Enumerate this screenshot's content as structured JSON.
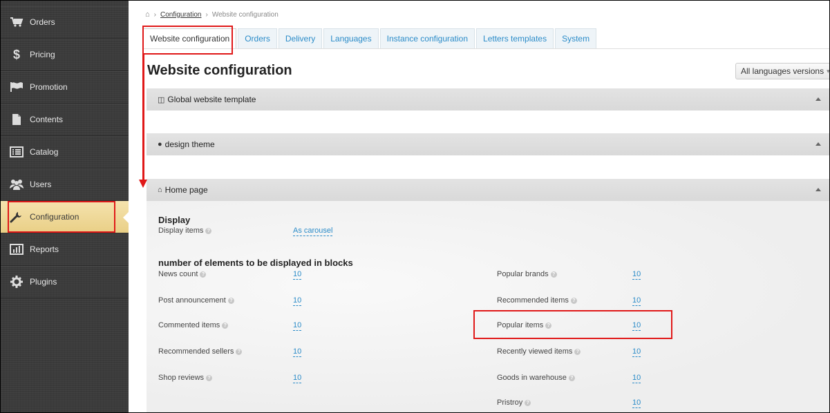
{
  "sidebar": {
    "items": [
      {
        "label": "Orders",
        "icon": "cart-icon"
      },
      {
        "label": "Pricing",
        "icon": "dollar-icon"
      },
      {
        "label": "Promotion",
        "icon": "flag-icon"
      },
      {
        "label": "Contents",
        "icon": "document-icon"
      },
      {
        "label": "Catalog",
        "icon": "list-icon"
      },
      {
        "label": "Users",
        "icon": "users-icon"
      },
      {
        "label": "Configuration",
        "icon": "wrench-icon"
      },
      {
        "label": "Reports",
        "icon": "bar-chart-icon"
      },
      {
        "label": "Plugins",
        "icon": "gear-icon"
      }
    ],
    "active": "Configuration"
  },
  "breadcrumb": {
    "home_icon": "home-icon",
    "link": "Configuration",
    "current": "Website configuration"
  },
  "tabs": [
    "Website configuration",
    "Orders",
    "Delivery",
    "Languages",
    "Instance configuration",
    "Letters templates",
    "System"
  ],
  "active_tab": "Website configuration",
  "page": {
    "title": "Website configuration",
    "lang_button": "All languages versions"
  },
  "panels": {
    "global": {
      "title": "Global website template"
    },
    "design": {
      "title": "design theme"
    },
    "home": {
      "title": "Home page"
    }
  },
  "display": {
    "title": "Display",
    "items_label": "Display items",
    "items_value": "As carousel"
  },
  "blocks": {
    "title": "number of elements to be displayed in blocks",
    "left": [
      {
        "label": "News count",
        "value": "10"
      },
      {
        "label": "Post announcement",
        "value": "10"
      },
      {
        "label": "Commented items",
        "value": "10"
      },
      {
        "label": "Recommended sellers",
        "value": "10"
      },
      {
        "label": "Shop reviews",
        "value": "10"
      }
    ],
    "right": [
      {
        "label": "Popular brands",
        "value": "10"
      },
      {
        "label": "Recommended items",
        "value": "10"
      },
      {
        "label": "Popular items",
        "value": "10"
      },
      {
        "label": "Recently viewed items",
        "value": "10"
      },
      {
        "label": "Goods in warehouse",
        "value": "10"
      },
      {
        "label": "Pristroy",
        "value": "10"
      }
    ]
  },
  "colors": {
    "accent": "#2a8bc8",
    "annotation": "#e01818",
    "active_menu": "#f0d99a"
  }
}
